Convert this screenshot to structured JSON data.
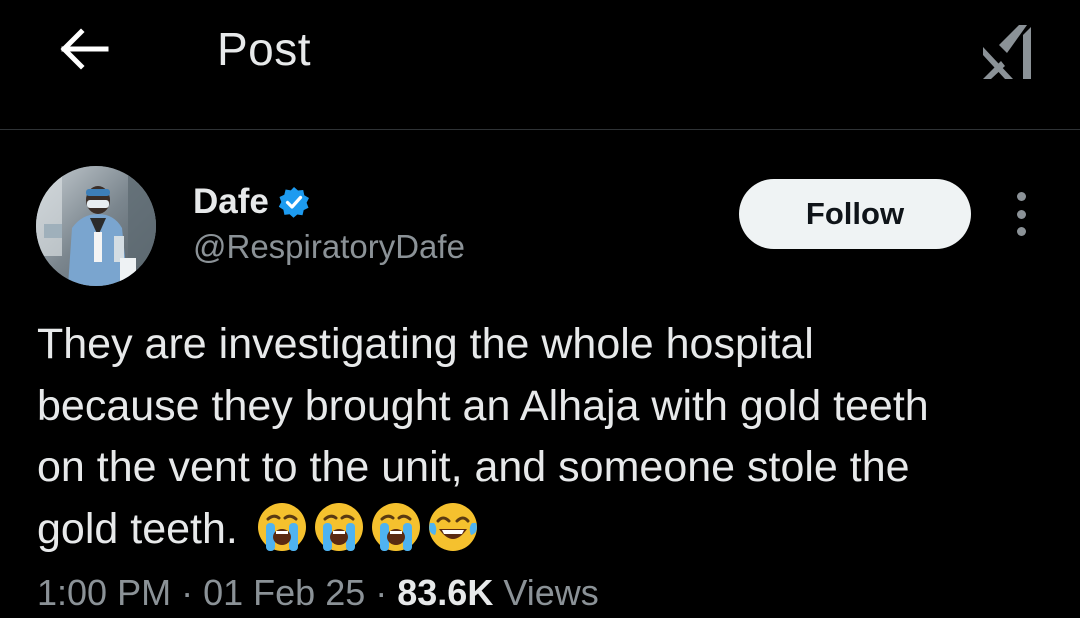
{
  "header": {
    "title": "Post"
  },
  "author": {
    "name": "Dafe",
    "handle": "@RespiratoryDafe",
    "verified": true
  },
  "follow_button": {
    "label": "Follow"
  },
  "post": {
    "text_lines": [
      "They are investigating the whole hospital",
      "because they brought an Alhaja with gold teeth",
      "on the vent to the unit, and someone stole the",
      "gold teeth."
    ],
    "emojis": [
      "loudly-crying-face",
      "loudly-crying-face",
      "loudly-crying-face",
      "face-with-tears-of-joy"
    ]
  },
  "meta": {
    "time": "1:00 PM",
    "separator": "·",
    "date": "01 Feb 25",
    "views_count": "83.6K",
    "views_label": "Views"
  },
  "colors": {
    "background": "#000000",
    "text_primary": "#e7e9ea",
    "text_secondary": "#8b9297",
    "verified_blue": "#1d9bf0",
    "follow_bg": "#eff3f4",
    "divider": "#2f3336"
  },
  "icons": {
    "back": "arrow-left-icon",
    "grok": "grok-logo-icon",
    "verified": "verified-badge-icon",
    "more": "more-vertical-icon"
  }
}
